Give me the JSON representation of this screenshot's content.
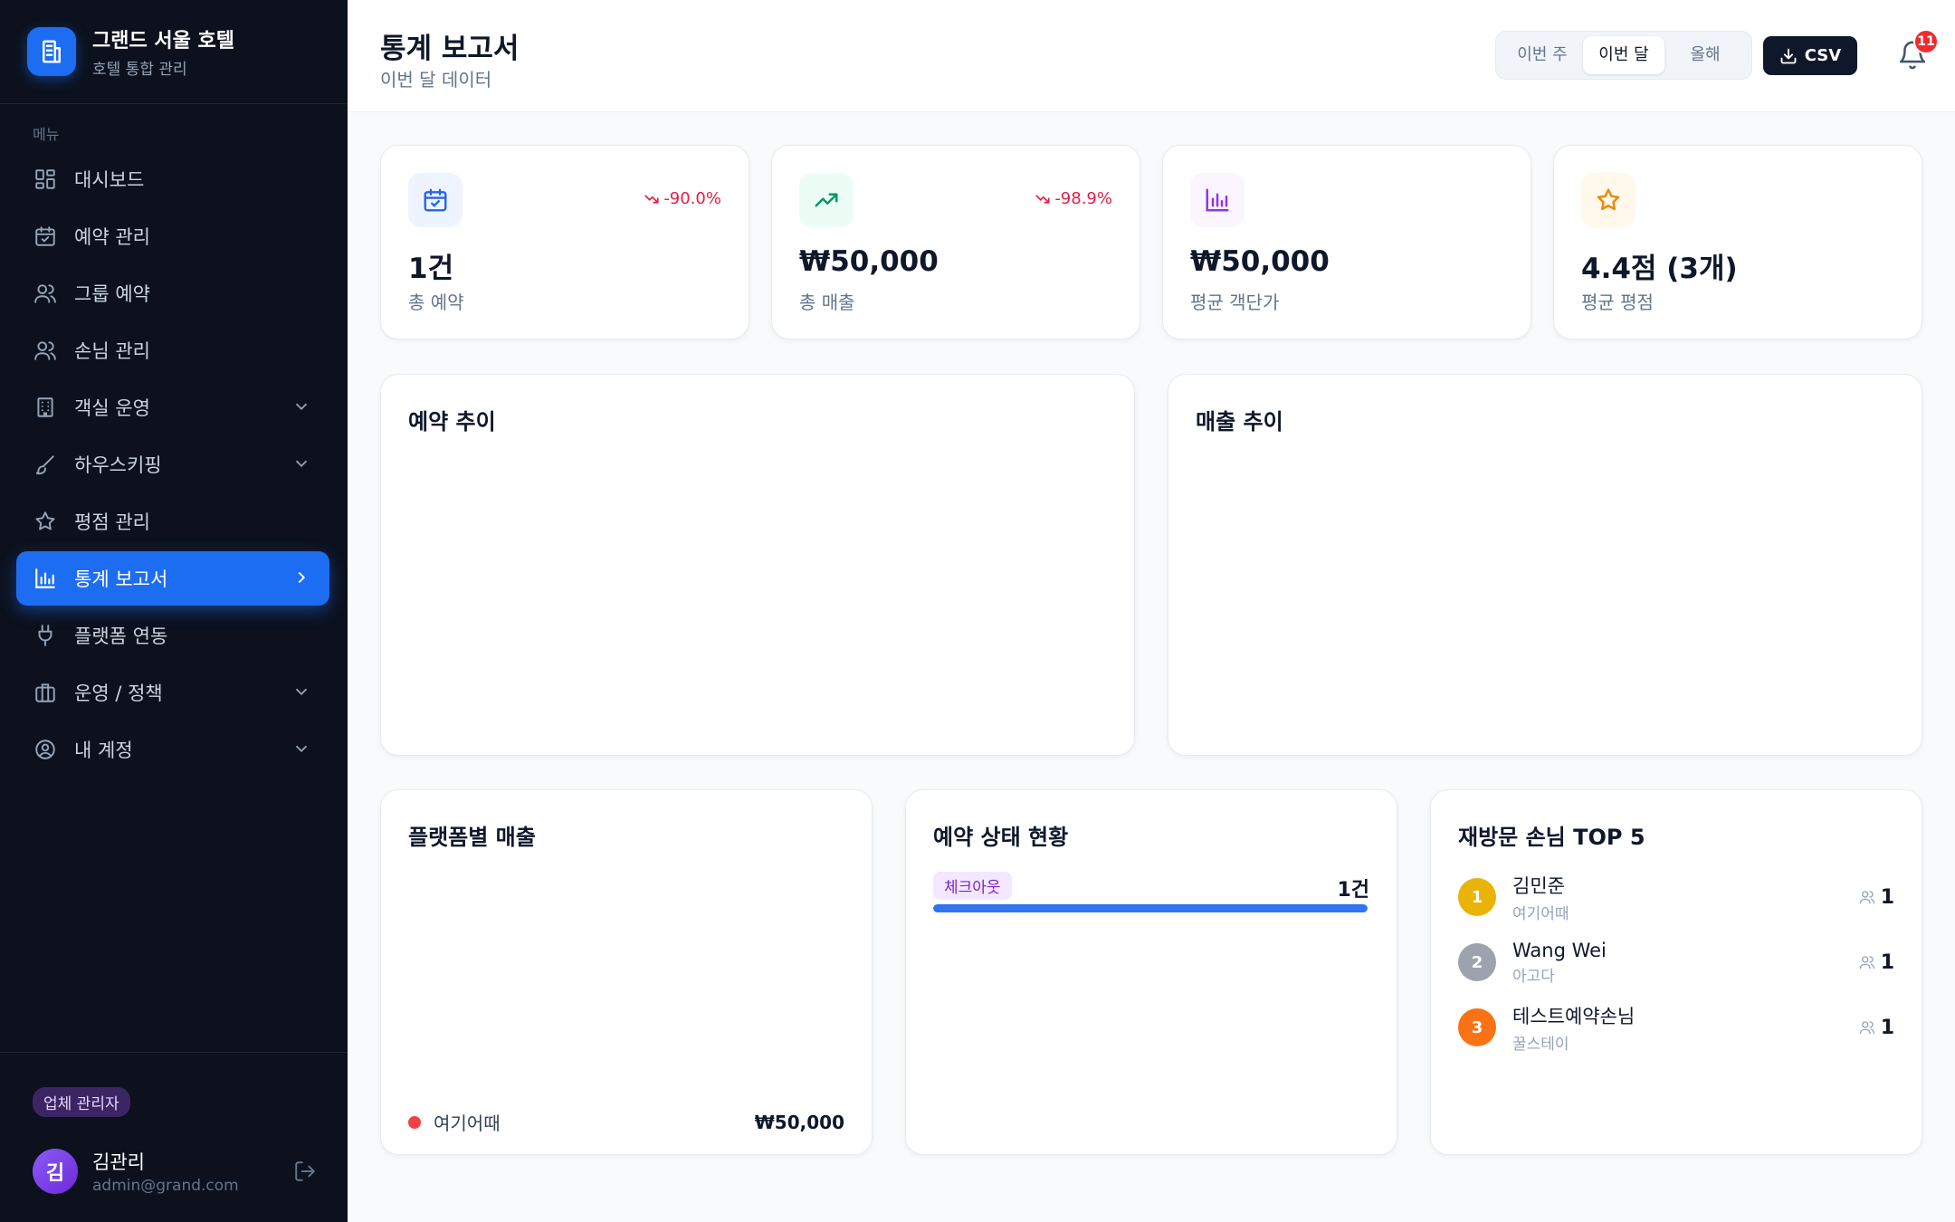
{
  "brand": {
    "title": "그랜드 서울 호텔",
    "subtitle": "호텔 통합 관리"
  },
  "sidebar": {
    "menu_label": "메뉴",
    "items": [
      {
        "label": "대시보드",
        "icon": "dashboard-icon"
      },
      {
        "label": "예약 관리",
        "icon": "calendar-check-icon"
      },
      {
        "label": "그룹 예약",
        "icon": "users-icon"
      },
      {
        "label": "손님 관리",
        "icon": "users-icon"
      },
      {
        "label": "객실 운영",
        "icon": "building-icon",
        "expandable": true
      },
      {
        "label": "하우스키핑",
        "icon": "brush-icon",
        "expandable": true
      },
      {
        "label": "평점 관리",
        "icon": "star-icon"
      },
      {
        "label": "통계 보고서",
        "icon": "bar-chart-icon",
        "active": true
      },
      {
        "label": "플랫폼 연동",
        "icon": "plug-icon"
      },
      {
        "label": "운영 / 정책",
        "icon": "briefcase-icon",
        "expandable": true
      },
      {
        "label": "내 계정",
        "icon": "user-circle-icon",
        "expandable": true
      }
    ],
    "footer": {
      "role": "업체 관리자",
      "avatar_initial": "김",
      "user_name": "김관리",
      "user_email": "admin@grand.com"
    }
  },
  "header": {
    "title": "통계 보고서",
    "subtitle": "이번 달 데이터",
    "periods": [
      "이번 주",
      "이번 달",
      "올해"
    ],
    "active_period": "이번 달",
    "csv_label": "CSV",
    "notification_count": "11"
  },
  "stats": [
    {
      "value": "1건",
      "label": "총 예약",
      "change": "-90.0%",
      "icon": "calendar-check-icon",
      "color": "#2563eb",
      "bg": "#eef4ff"
    },
    {
      "value": "₩50,000",
      "label": "총 매출",
      "change": "-98.9%",
      "icon": "trending-up-icon",
      "color": "#059669",
      "bg": "#ecfdf5"
    },
    {
      "value": "₩50,000",
      "label": "평균 객단가",
      "change": "",
      "icon": "bar-chart-icon",
      "color": "#9333ea",
      "bg": "#faf5ff"
    },
    {
      "value": "4.4점 (3개)",
      "label": "평균 평점",
      "change": "",
      "icon": "star-icon",
      "color": "#ea8a0c",
      "bg": "#fff8eb"
    }
  ],
  "charts": {
    "reservation_trend_title": "예약 추이",
    "revenue_trend_title": "매출 추이"
  },
  "platform_revenue": {
    "title": "플랫폼별 매출",
    "items": [
      {
        "name": "여기어때",
        "value": "₩50,000",
        "color": "#ef4444"
      }
    ]
  },
  "reservation_status": {
    "title": "예약 상태 현황",
    "items": [
      {
        "label": "체크아웃",
        "count": "1건",
        "fraction": 1.0
      }
    ]
  },
  "top_guests": {
    "title": "재방문 손님 TOP 5",
    "items": [
      {
        "rank": "1",
        "name": "김민준",
        "source": "여기어때",
        "visits": "1",
        "color": "#eab308"
      },
      {
        "rank": "2",
        "name": "Wang Wei",
        "source": "아고다",
        "visits": "1",
        "color": "#9ca3af"
      },
      {
        "rank": "3",
        "name": "테스트예약손님",
        "source": "꿀스테이",
        "visits": "1",
        "color": "#f97316"
      }
    ]
  }
}
